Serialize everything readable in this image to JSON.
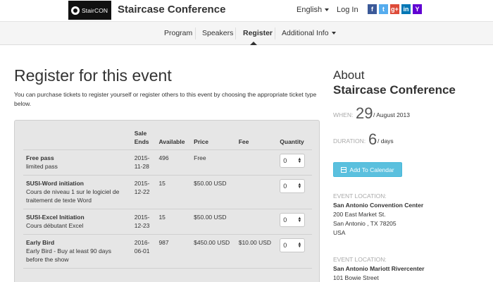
{
  "header": {
    "logo_text": "StairCON",
    "site_title": "Staircase Conference",
    "language": "English",
    "login": "Log In",
    "social": [
      {
        "icon": "facebook-icon",
        "glyph": "f",
        "color": "#3b5998"
      },
      {
        "icon": "twitter-icon",
        "glyph": "t",
        "color": "#55acee"
      },
      {
        "icon": "googleplus-icon",
        "glyph": "g+",
        "color": "#dd4b39"
      },
      {
        "icon": "linkedin-icon",
        "glyph": "in",
        "color": "#0077b5"
      },
      {
        "icon": "yahoo-icon",
        "glyph": "Y",
        "color": "#6001d2"
      }
    ]
  },
  "nav": {
    "items": [
      "Program",
      "Speakers",
      "Register",
      "Additional Info"
    ],
    "active": "Register"
  },
  "main": {
    "title": "Register for this event",
    "intro": "You can purchase tickets to register yourself or register others to this event by choosing the appropriate ticket type below.",
    "table": {
      "headers": {
        "sale_ends_1": "Sale",
        "sale_ends_2": "Ends",
        "available": "Available",
        "price": "Price",
        "fee": "Fee",
        "quantity": "Quantity"
      },
      "rows": [
        {
          "name": "Free pass",
          "desc": "limited pass",
          "date_1": "2015-",
          "date_2": "11-28",
          "available": "496",
          "price": "Free",
          "fee": "",
          "qty": "0"
        },
        {
          "name": "SUSI-Word initiation",
          "desc": "Cours de niveau 1 sur le logiciel de traitement de texte Word",
          "date_1": "2015-",
          "date_2": "12-22",
          "available": "15",
          "price": "$50.00 USD",
          "fee": "",
          "qty": "0"
        },
        {
          "name": "SUSI-Excel Initiation",
          "desc": "Cours débutant Excel",
          "date_1": "2015-",
          "date_2": "12-23",
          "available": "15",
          "price": "$50.00 USD",
          "fee": "",
          "qty": "0"
        },
        {
          "name": "Early Bird",
          "desc": "Early Bird - Buy at least 90 days before the show",
          "date_1": "2016-",
          "date_2": "06-01",
          "available": "987",
          "price": "$450.00 USD",
          "fee": "$10.00 USD",
          "qty": "0"
        }
      ]
    }
  },
  "sidebar": {
    "about": "About",
    "conference": "Staircase Conference",
    "when_label": "WHEN:",
    "when_day": "29",
    "when_rest": "/ August 2013",
    "duration_label": "DURATION:",
    "duration_num": "6",
    "duration_rest": "/ days",
    "calendar_button": "Add To Calendar",
    "locations": [
      {
        "label": "EVENT LOCATION:",
        "name": "San Antonio Convention Center",
        "lines": [
          "200 East Market St.",
          "San Antonio , TX 78205",
          "USA"
        ]
      },
      {
        "label": "EVENT LOCATION:",
        "name": "San Antonio Mariott Rivercenter",
        "lines": [
          "101 Bowie Street"
        ]
      }
    ]
  }
}
